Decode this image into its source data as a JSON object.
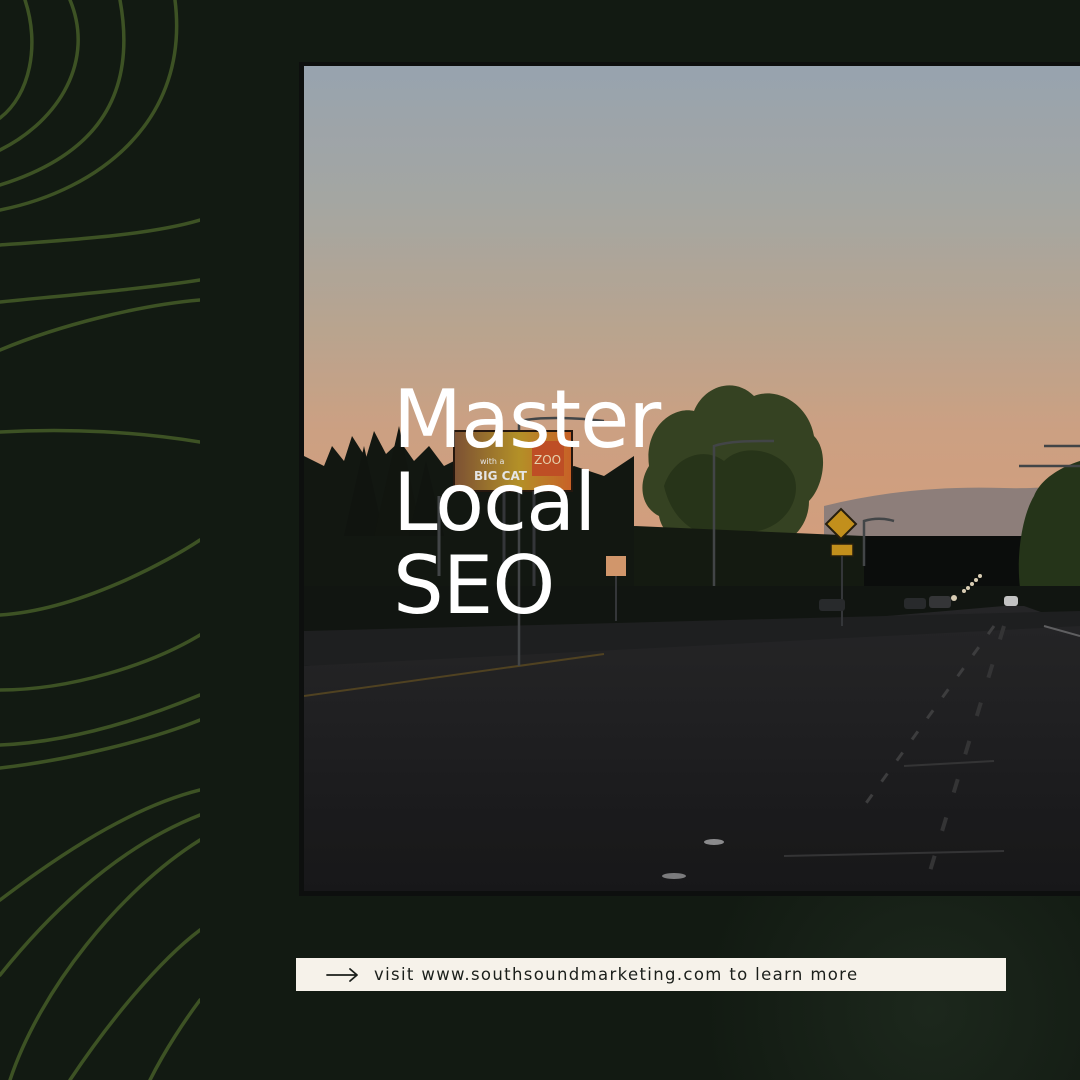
{
  "headline": {
    "line1": "Master",
    "line2": "Local",
    "line3": "SEO"
  },
  "cta": {
    "arrow_icon": "arrow-right-icon",
    "text": "visit www.southsoundmarketing.com to learn more"
  },
  "billboard": {
    "line1": "with a",
    "line2": "BIG CAT",
    "brand": "ZOO"
  },
  "colors": {
    "background": "#121a12",
    "topo_line": "#3d5224",
    "cta_background": "#f6f2ea",
    "headline": "#ffffff"
  }
}
